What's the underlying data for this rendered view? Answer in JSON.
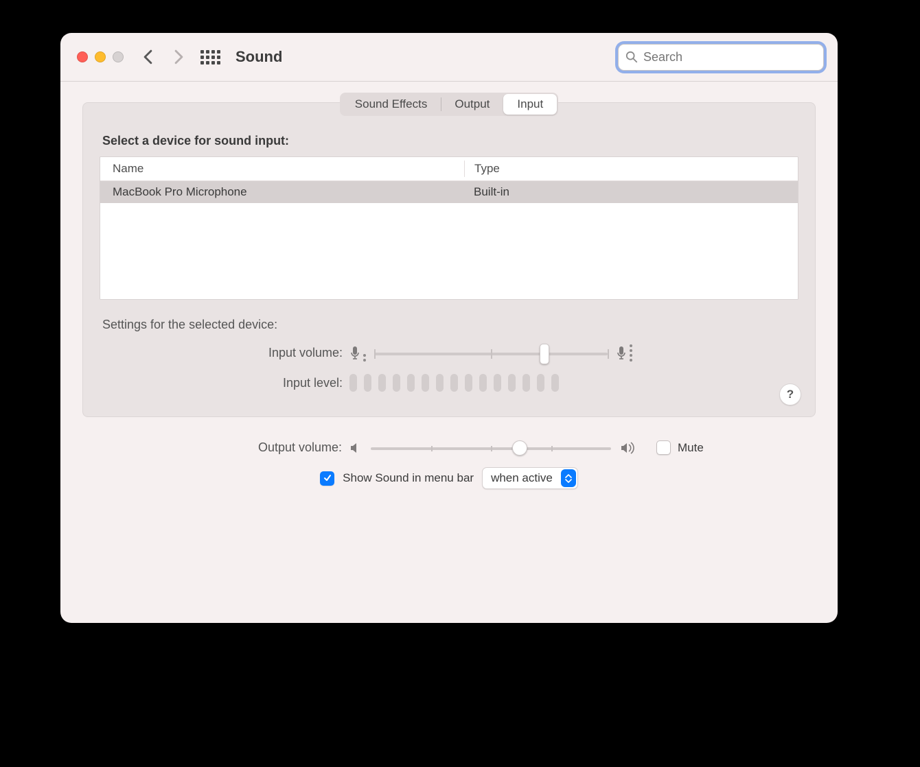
{
  "window": {
    "title": "Sound"
  },
  "search": {
    "placeholder": "Search"
  },
  "tabs": [
    "Sound Effects",
    "Output",
    "Input"
  ],
  "active_tab_index": 2,
  "input_section": {
    "heading": "Select a device for sound input:",
    "columns": {
      "name": "Name",
      "type": "Type"
    },
    "devices": [
      {
        "name": "MacBook Pro Microphone",
        "type": "Built-in",
        "selected": true
      }
    ]
  },
  "settings": {
    "heading": "Settings for the selected device:",
    "input_volume_label": "Input volume:",
    "input_volume_percent": 73,
    "input_level_label": "Input level:",
    "input_level_segments": 15,
    "input_level_active": 0
  },
  "output": {
    "label": "Output volume:",
    "percent": 62,
    "mute_label": "Mute",
    "mute_checked": false
  },
  "menubar": {
    "checkbox_label": "Show Sound in menu bar",
    "checked": true,
    "dropdown_value": "when active"
  },
  "help_label": "?"
}
